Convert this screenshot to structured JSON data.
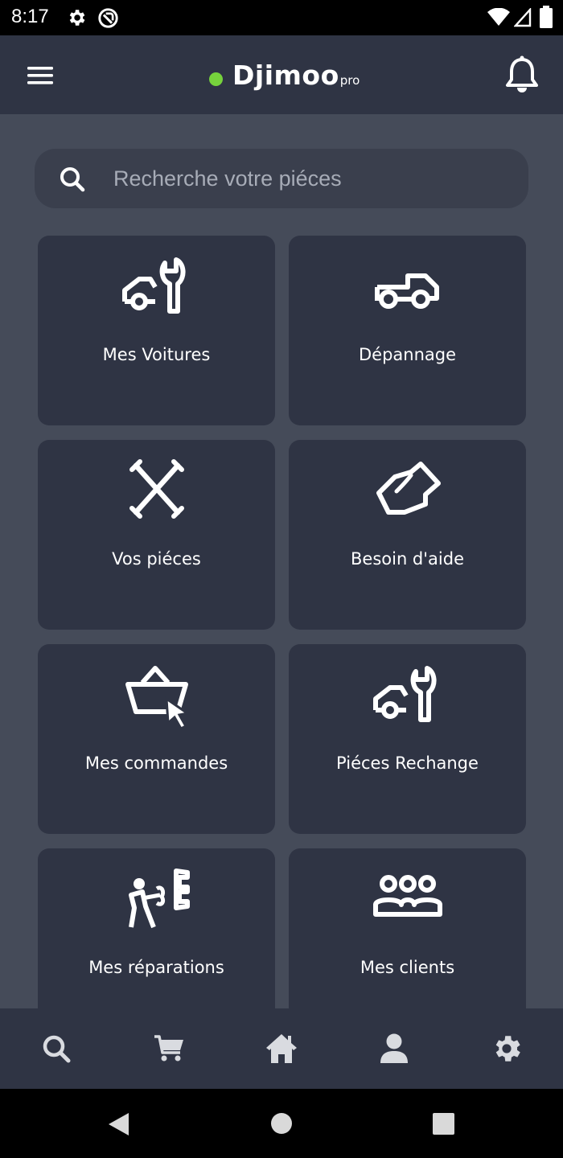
{
  "status_bar": {
    "time": "8:17",
    "icons": [
      "settings-icon",
      "no-entry-icon",
      "wifi-icon",
      "signal-icon",
      "battery-icon"
    ]
  },
  "app_bar": {
    "brand_name": "Djimoo",
    "brand_suffix": "pro",
    "status_dot_color": "#76d23c",
    "icons": [
      "hamburger-menu-icon",
      "bell-icon"
    ]
  },
  "search": {
    "placeholder": "Recherche votre piéces",
    "value": ""
  },
  "tiles": [
    {
      "label": "Mes Voitures",
      "icon": "car-wrench-icon"
    },
    {
      "label": "Dépannage",
      "icon": "tow-truck-icon"
    },
    {
      "label": "Vos piéces",
      "icon": "crossed-tools-icon"
    },
    {
      "label": "Besoin d'aide",
      "icon": "helping-hand-icon"
    },
    {
      "label": "Mes commandes",
      "icon": "basket-cursor-icon"
    },
    {
      "label": "Piéces Rechange",
      "icon": "car-wrench-icon"
    },
    {
      "label": "Mes réparations",
      "icon": "mechanic-icon"
    },
    {
      "label": "Mes clients",
      "icon": "group-icon"
    }
  ],
  "bottom_nav": [
    "search-icon",
    "cart-icon",
    "home-icon",
    "user-icon",
    "gear-icon"
  ],
  "colors": {
    "app_bar": "#2f3444",
    "content_bg": "#454b59",
    "tile_bg": "#2f3444",
    "search_bg": "#3a3f4d",
    "nav_icon": "#d9dbe0"
  }
}
